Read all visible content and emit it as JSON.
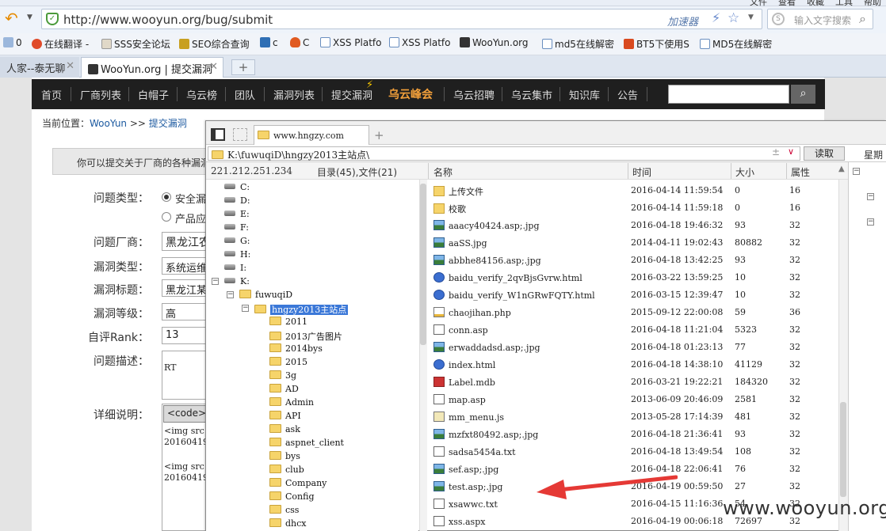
{
  "browser": {
    "window_menu": [
      "文件",
      "查看",
      "收藏",
      "工具",
      "帮助"
    ],
    "url": "http://www.wooyun.org/bug/submit",
    "accelerator_label": "加速器",
    "search_placeholder": "输入文字搜索",
    "bookmarks": [
      "0",
      "在线翻译 -",
      "SSS安全论坛",
      "SEO综合查询",
      "c",
      "C",
      "XSS Platfo",
      "XSS Platfo",
      "WooYun.org",
      "md5在线解密",
      "BT5下使用S",
      "MD5在线解密"
    ],
    "tabs": [
      {
        "label": "人家--泰无聊"
      },
      {
        "label": "WooYun.org | 提交漏洞"
      }
    ],
    "new_tab": "+"
  },
  "site": {
    "nav": [
      "首页",
      "厂商列表",
      "白帽子",
      "乌云榜",
      "团队",
      "漏洞列表",
      "提交漏洞",
      "乌云峰会",
      "乌云招聘",
      "乌云集市",
      "知识库",
      "公告"
    ],
    "search_button": "🔍",
    "breadcrumb_prefix": "当前位置：",
    "breadcrumb_home": "WooYun",
    "breadcrumb_sep": " >> ",
    "breadcrumb_current": "提交漏洞",
    "notice": "你可以提交关于厂商的各种漏洞",
    "form": {
      "type_label": "问题类型：",
      "type_option1": "安全漏洞",
      "type_option2": "产品应",
      "vendor_label": "问题厂商：",
      "vendor_value": "黑龙江农",
      "bugtype_label": "漏洞类型：",
      "bugtype_value": "系统运维",
      "title_label": "漏洞标题：",
      "title_value": "黑龙江某",
      "level_label": "漏洞等级：",
      "level_value": "高",
      "rank_label": "自评Rank：",
      "rank_value": "13",
      "desc_label": "问题描述：",
      "desc_value": "RT",
      "detail_label": "详细说明：",
      "code_button": "<code>",
      "detail_lines": [
        "<img src",
        "20160419",
        "<img src",
        "20160419"
      ]
    }
  },
  "file_manager": {
    "tab_label": "www.hngzy.com",
    "tab_plus": "+",
    "path": "K:\\fuwuqiD\\hngzy2013主站点\\",
    "path_plus": "±",
    "path_drop": "∨",
    "read_button": "读取",
    "right_fragment": "星期",
    "ip": "221.212.251.234",
    "summary": "目录(45),文件(21)",
    "columns": {
      "name": "名称",
      "time": "时间",
      "size": "大小",
      "attr": "属性"
    },
    "drives": [
      "C:",
      "D:",
      "E:",
      "F:",
      "G:",
      "H:",
      "I:",
      "K:"
    ],
    "tree": {
      "root_folder": "fuwuqiD",
      "selected_folder": "hngzy2013主站点",
      "subfolders": [
        "2011",
        "2013广告图片",
        "2014bys",
        "2015",
        "3g",
        "AD",
        "Admin",
        "API",
        "ask",
        "aspnet_client",
        "bys",
        "club",
        "Company",
        "Config",
        "css",
        "dhcx"
      ]
    },
    "files": [
      {
        "name": "上传文件",
        "time": "2016-04-14 11:59:54",
        "size": "0",
        "attr": "16",
        "icon": "folder"
      },
      {
        "name": "校歌",
        "time": "2016-04-14 11:59:18",
        "size": "0",
        "attr": "16",
        "icon": "folder"
      },
      {
        "name": "aaacy40424.asp;.jpg",
        "time": "2016-04-18 19:46:32",
        "size": "93",
        "attr": "32",
        "icon": "image"
      },
      {
        "name": "aaSS.jpg",
        "time": "2014-04-11 19:02:43",
        "size": "80882",
        "attr": "32",
        "icon": "image"
      },
      {
        "name": "abbhe84156.asp;.jpg",
        "time": "2016-04-18 13:42:25",
        "size": "93",
        "attr": "32",
        "icon": "image"
      },
      {
        "name": "baidu_verify_2qvBjsGvrw.html",
        "time": "2016-03-22 13:59:25",
        "size": "10",
        "attr": "32",
        "icon": "html"
      },
      {
        "name": "baidu_verify_W1nGRwFQTY.html",
        "time": "2016-03-15 12:39:47",
        "size": "10",
        "attr": "32",
        "icon": "html"
      },
      {
        "name": "chaojihan.php",
        "time": "2015-09-12 22:00:08",
        "size": "59",
        "attr": "36",
        "icon": "php"
      },
      {
        "name": "conn.asp",
        "time": "2016-04-18 11:21:04",
        "size": "5323",
        "attr": "32",
        "icon": "file"
      },
      {
        "name": "erwaddadsd.asp;.jpg",
        "time": "2016-04-18 01:23:13",
        "size": "77",
        "attr": "32",
        "icon": "image"
      },
      {
        "name": "index.html",
        "time": "2016-04-18 14:38:10",
        "size": "41129",
        "attr": "32",
        "icon": "html"
      },
      {
        "name": "Label.mdb",
        "time": "2016-03-21 19:22:21",
        "size": "184320",
        "attr": "32",
        "icon": "mdb"
      },
      {
        "name": "map.asp",
        "time": "2013-06-09 20:46:09",
        "size": "2581",
        "attr": "32",
        "icon": "file"
      },
      {
        "name": "mm_menu.js",
        "time": "2013-05-28 17:14:39",
        "size": "481",
        "attr": "32",
        "icon": "js"
      },
      {
        "name": "mzfxt80492.asp;.jpg",
        "time": "2016-04-18 21:36:41",
        "size": "93",
        "attr": "32",
        "icon": "image"
      },
      {
        "name": "sadsa5454a.txt",
        "time": "2016-04-18 13:49:54",
        "size": "108",
        "attr": "32",
        "icon": "file"
      },
      {
        "name": "sef.asp;.jpg",
        "time": "2016-04-18 22:06:41",
        "size": "76",
        "attr": "32",
        "icon": "image"
      },
      {
        "name": "test.asp;.jpg",
        "time": "2016-04-19 00:59:50",
        "size": "27",
        "attr": "32",
        "icon": "image"
      },
      {
        "name": "xsawwc.txt",
        "time": "2016-04-15 11:16:36",
        "size": "54",
        "attr": "32",
        "icon": "file"
      },
      {
        "name": "xss.aspx",
        "time": "2016-04-19 00:06:18",
        "size": "72697",
        "attr": "32",
        "icon": "file"
      }
    ]
  },
  "watermark": "www.wooyun.org",
  "colors": {
    "nav_bg": "#1f1f1f",
    "nav_hot": "#f3a03a",
    "arrow": "#e53935",
    "selection": "#3b78d8"
  }
}
